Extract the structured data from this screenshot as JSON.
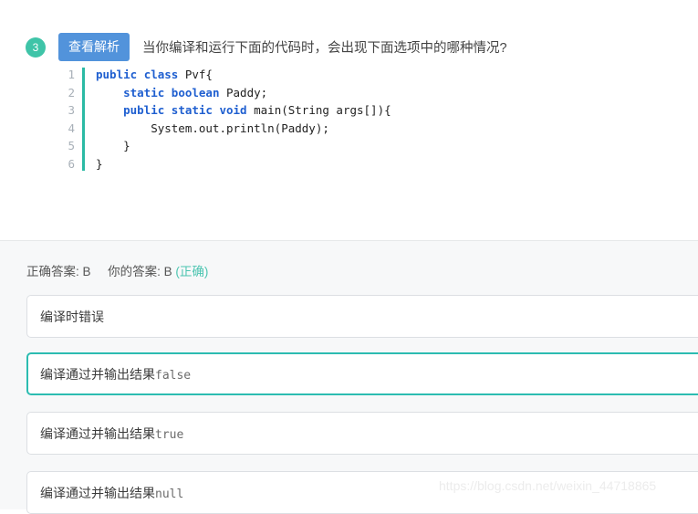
{
  "question": {
    "number": "3",
    "analysis_button_label": "查看解析",
    "text": "当你编译和运行下面的代码时，会出现下面选项中的哪种情况?",
    "code": {
      "line_numbers": [
        "1",
        "2",
        "3",
        "4",
        "5",
        "6"
      ],
      "lines": [
        [
          {
            "t": "public",
            "c": "kw"
          },
          {
            "t": " ",
            "c": "id"
          },
          {
            "t": "class",
            "c": "kw"
          },
          {
            "t": " Pvf{",
            "c": "id"
          }
        ],
        [
          {
            "t": "    ",
            "c": "id"
          },
          {
            "t": "static",
            "c": "kw"
          },
          {
            "t": " ",
            "c": "id"
          },
          {
            "t": "boolean",
            "c": "kw"
          },
          {
            "t": " Paddy;",
            "c": "id"
          }
        ],
        [
          {
            "t": "    ",
            "c": "id"
          },
          {
            "t": "public",
            "c": "kw"
          },
          {
            "t": " ",
            "c": "id"
          },
          {
            "t": "static",
            "c": "kw"
          },
          {
            "t": " ",
            "c": "id"
          },
          {
            "t": "void",
            "c": "kw"
          },
          {
            "t": " main(String args[]){",
            "c": "id"
          }
        ],
        [
          {
            "t": "        System.out.println(Paddy);",
            "c": "id"
          }
        ],
        [
          {
            "t": "    }",
            "c": "id"
          }
        ],
        [
          {
            "t": "}",
            "c": "id"
          }
        ]
      ]
    }
  },
  "answer": {
    "correct_label": "正确答案:",
    "correct_value": "B",
    "your_label": "你的答案:",
    "your_value": "B",
    "verdict": "(正确)"
  },
  "options": [
    {
      "key": "A",
      "text": "编译时错误",
      "mono": "",
      "selected": false
    },
    {
      "key": "B",
      "text": "编译通过并输出结果",
      "mono": "false",
      "selected": true
    },
    {
      "key": "C",
      "text": "编译通过并输出结果",
      "mono": "true",
      "selected": false
    },
    {
      "key": "D",
      "text": "编译通过并输出结果",
      "mono": "null",
      "selected": false
    }
  ],
  "watermark": "https://blog.csdn.net/weixin_44718865",
  "colors": {
    "badge_green": "#3fc4a8",
    "button_blue": "#5293db",
    "selected_teal": "#2cbcb1",
    "verdict_green": "#4ac4b0",
    "keyword_blue": "#1f5fd0",
    "panel_gray": "#f7f8f9"
  }
}
